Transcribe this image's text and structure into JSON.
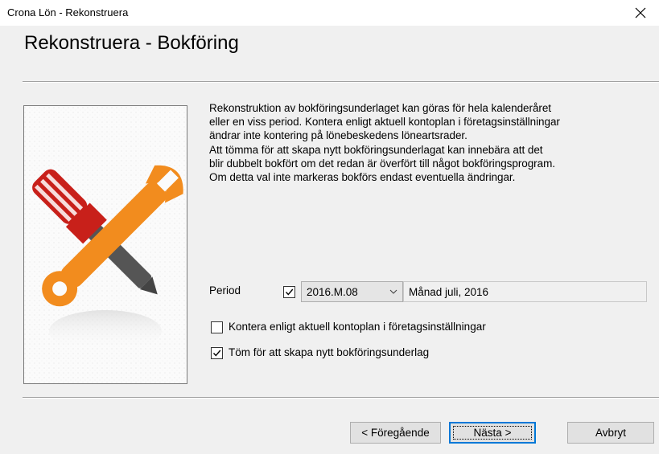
{
  "window": {
    "title": "Crona Lön - Rekonstruera"
  },
  "header": {
    "title": "Rekonstruera - Bokföring"
  },
  "description": "Rekonstruktion av bokföringsunderlaget kan göras för hela kalenderåret\neller en viss period. Kontera enligt aktuell kontoplan i företagsinställningar\nändrar inte kontering på lönebeskedens löneartsrader.\nAtt tömma för att skapa nytt bokföringsunderlagat kan innebära att det\nblir dubbelt bokfört om det redan är överfört till något bokföringsprogram.\nOm detta val inte markeras bokförs endast eventuella ändringar.",
  "period": {
    "label": "Period",
    "enabled": true,
    "selected": "2016.M.08",
    "month_text": "Månad juli, 2016"
  },
  "options": [
    {
      "label": "Kontera enligt aktuell kontoplan i företagsinställningar",
      "checked": false
    },
    {
      "label": "Töm för att skapa nytt bokföringsunderlag",
      "checked": true
    }
  ],
  "buttons": {
    "previous": "< Föregående",
    "next": "Nästa >",
    "cancel": "Avbryt"
  },
  "icons": {
    "image": "wrench-screwdriver-icon",
    "close": "close-icon",
    "dropdown": "chevron-down-icon"
  },
  "colors": {
    "accent": "#0078d7",
    "wrench": "#f28c1e",
    "screwdriver_handle": "#c8201a"
  }
}
